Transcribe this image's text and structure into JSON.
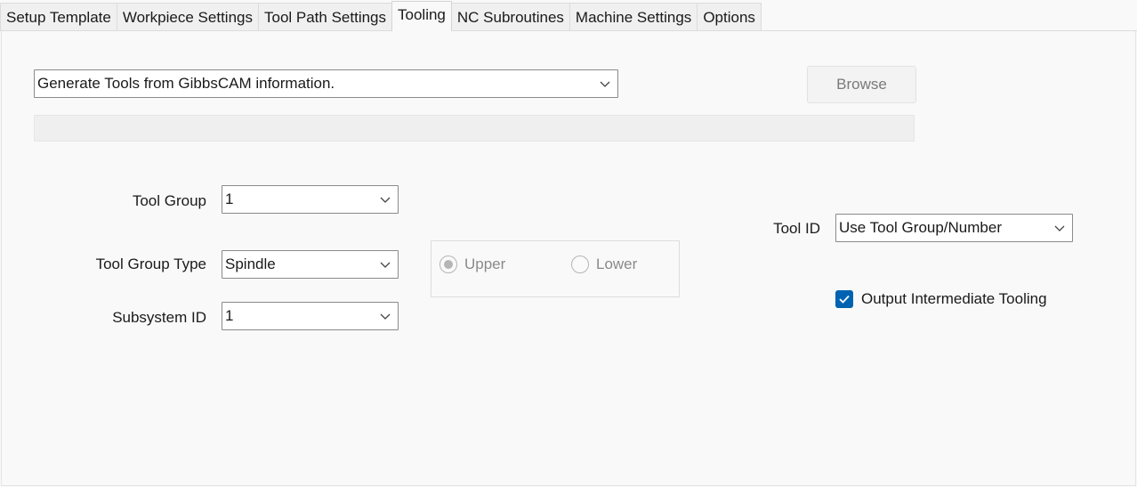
{
  "tabs": [
    {
      "label": "Setup Template"
    },
    {
      "label": "Workpiece Settings"
    },
    {
      "label": "Tool Path Settings"
    },
    {
      "label": "Tooling",
      "active": true
    },
    {
      "label": "NC Subroutines"
    },
    {
      "label": "Machine Settings"
    },
    {
      "label": "Options"
    }
  ],
  "generate": {
    "selected": "Generate Tools from GibbsCAM information.",
    "browse_label": "Browse"
  },
  "tool_group": {
    "label": "Tool Group",
    "value": "1"
  },
  "tool_group_type": {
    "label": "Tool Group Type",
    "value": "Spindle"
  },
  "subsystem_id": {
    "label": "Subsystem ID",
    "value": "1"
  },
  "position": {
    "upper": {
      "label": "Upper",
      "checked": true
    },
    "lower": {
      "label": "Lower",
      "checked": false
    }
  },
  "tool_id": {
    "label": "Tool ID",
    "value": "Use Tool Group/Number"
  },
  "output_intermediate": {
    "label": "Output Intermediate Tooling",
    "checked": true
  },
  "colors": {
    "accent": "#0063b1",
    "disabled_text": "#8a8a8a"
  }
}
